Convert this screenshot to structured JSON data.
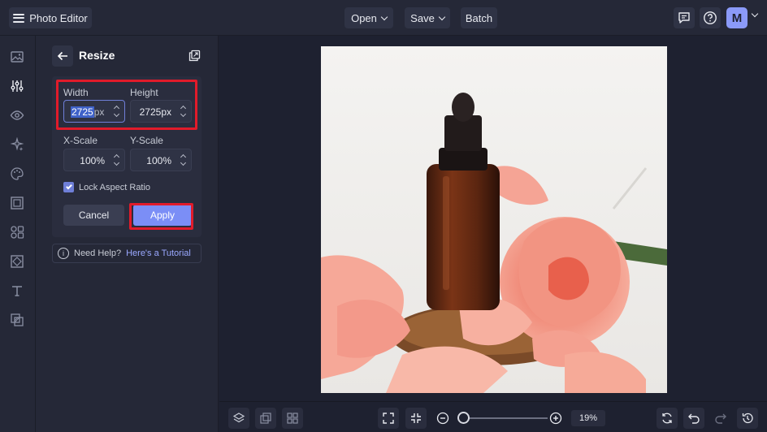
{
  "app": {
    "title": "Photo Editor"
  },
  "topbar": {
    "open_label": "Open",
    "save_label": "Save",
    "batch_label": "Batch",
    "avatar_initial": "M"
  },
  "rail": {
    "icons": [
      "image-icon",
      "adjust-sliders-icon",
      "eye-icon",
      "sparkle-effects-icon",
      "palette-icon",
      "frame-icon",
      "shapes-icon",
      "texture-icon",
      "text-icon",
      "overlay-icon"
    ],
    "active_color": "#e6e8ee"
  },
  "panel": {
    "title": "Resize",
    "width_label": "Width",
    "height_label": "Height",
    "width_value": "2725",
    "width_unit": "px",
    "height_value": "2725px",
    "xscale_label": "X-Scale",
    "yscale_label": "Y-Scale",
    "xscale_value": "100%",
    "yscale_value": "100%",
    "lock_label": "Lock Aspect Ratio",
    "lock_checked": true,
    "cancel_label": "Cancel",
    "apply_label": "Apply",
    "help_text": "Need Help?",
    "help_link": "Here's a Tutorial"
  },
  "zoom": {
    "value_text": "19%",
    "level": 0.19
  },
  "colors": {
    "accent": "#7b8ef6",
    "highlight": "#e11b2a",
    "background": "#1e2130",
    "panel": "#252837"
  }
}
